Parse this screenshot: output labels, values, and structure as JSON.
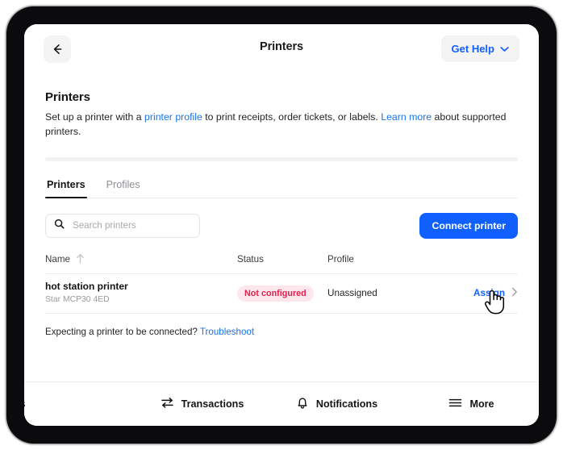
{
  "topbar": {
    "back_icon": "arrow-left-icon",
    "title": "Printers",
    "get_help_label": "Get Help",
    "get_help_chevron": "chevron-down-icon"
  },
  "page": {
    "heading": "Printers",
    "desc_part1": "Set up a printer with a ",
    "desc_link1": "printer profile",
    "desc_part2": " to print receipts, order tickets, or labels. ",
    "desc_link2": "Learn more",
    "desc_part3": " about supported printers."
  },
  "tabs": [
    {
      "label": "Printers",
      "active": true
    },
    {
      "label": "Profiles",
      "active": false
    }
  ],
  "toolbar": {
    "search_placeholder": "Search printers",
    "search_value": "",
    "search_icon": "search-icon",
    "connect_label": "Connect printer"
  },
  "table": {
    "columns": {
      "name": "Name",
      "status": "Status",
      "profile": "Profile"
    },
    "sort_icon": "sort-ascending-arrow-icon",
    "rows": [
      {
        "name": "hot station printer",
        "model": "Star MCP30 4ED",
        "status": "Not configured",
        "status_bg": "#fde7ed",
        "status_color": "#e1214b",
        "profile": "Unassigned",
        "action": "Assign",
        "action_chevron": "chevron-right-icon"
      }
    ]
  },
  "footnote": {
    "text": "Expecting a printer to be connected? ",
    "link": "Troubleshoot"
  },
  "bottom_nav": [
    {
      "label": "rders",
      "icon": "orders-icon",
      "clipped": true
    },
    {
      "label": "Transactions",
      "icon": "transactions-icon",
      "clipped": false
    },
    {
      "label": "Notifications",
      "icon": "bell-icon",
      "clipped": false
    },
    {
      "label": "More",
      "icon": "hamburger-menu-icon",
      "clipped": false
    }
  ],
  "cursor": {
    "type": "pointing-hand-cursor"
  },
  "colors": {
    "accent": "#1060ff",
    "link": "#1a73e8",
    "frame": "#0b0b0d"
  }
}
